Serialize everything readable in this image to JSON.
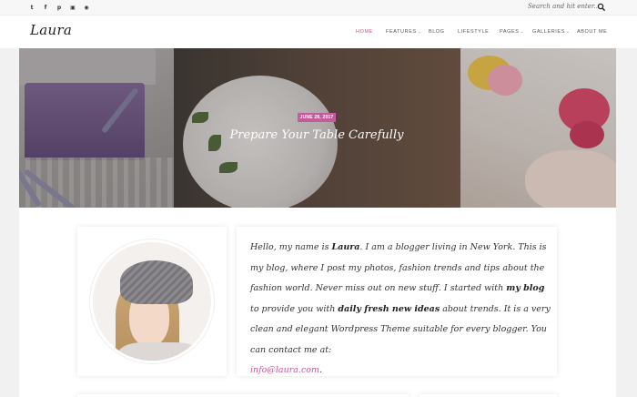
{
  "topbar": {
    "social_icons": [
      "twitter-icon",
      "facebook-icon",
      "pinterest-icon",
      "instagram-icon",
      "dribbble-icon"
    ],
    "social_glyphs": [
      "t",
      "f",
      "p",
      "▣",
      "◉"
    ],
    "search_placeholder": "Search and hit enter..."
  },
  "header": {
    "logo": "Laura",
    "nav": [
      {
        "label": "HOME",
        "active": true,
        "has_dropdown": false
      },
      {
        "label": "FEATURES",
        "active": false,
        "has_dropdown": true
      },
      {
        "label": "BLOG",
        "active": false,
        "has_dropdown": false
      },
      {
        "label": "LIFESTYLE",
        "active": false,
        "has_dropdown": false
      },
      {
        "label": "PAGES",
        "active": false,
        "has_dropdown": true
      },
      {
        "label": "GALLERIES",
        "active": false,
        "has_dropdown": true
      },
      {
        "label": "ABOUT ME",
        "active": false,
        "has_dropdown": false
      }
    ]
  },
  "hero": {
    "date": "JUNE 28, 2017",
    "title": "Prepare Your Table Carefully"
  },
  "about": {
    "bio_1": "Hello, my name is ",
    "bio_name": "Laura",
    "bio_2": ". I am a blogger living in New York. This is my blog, where I post my photos, fashion trends and tips about the fashion world. Never miss out on new stuff. I started with ",
    "bio_blog": "my blog",
    "bio_3": " to provide you with ",
    "bio_ideas": "daily fresh new ideas",
    "bio_4": " about trends. It is a very clean and elegant Wordpress Theme suitable for every blogger. You can contact me at:",
    "email": "info@laura.com",
    "email_end": "."
  },
  "colors": {
    "accent": "#c45b9a",
    "nav_active": "#c45b7d"
  }
}
